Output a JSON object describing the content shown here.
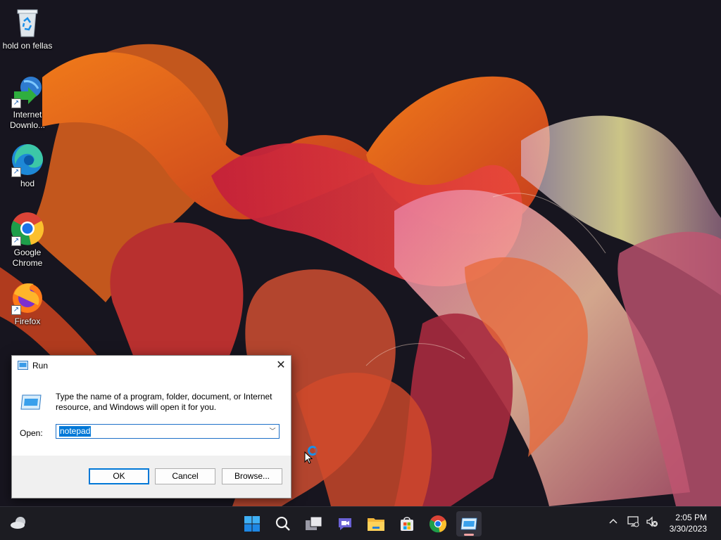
{
  "desktop": {
    "icons": [
      {
        "label": "hold on fellas",
        "icon": "recycle-bin-icon"
      },
      {
        "label": "Internet Downlo...",
        "icon": "internet-download-manager-icon"
      },
      {
        "label": "hod",
        "icon": "edge-icon"
      },
      {
        "label": "Google Chrome",
        "icon": "chrome-icon"
      },
      {
        "label": "Firefox",
        "icon": "firefox-icon"
      }
    ]
  },
  "run_dialog": {
    "title": "Run",
    "description": "Type the name of a program, folder, document, or Internet resource, and Windows will open it for you.",
    "open_label": "Open:",
    "open_value": "notepad",
    "ok_label": "OK",
    "cancel_label": "Cancel",
    "browse_label": "Browse..."
  },
  "taskbar": {
    "items": [
      "start-icon",
      "search-icon",
      "task-view-icon",
      "teams-chat-icon",
      "file-explorer-icon",
      "microsoft-store-icon",
      "chrome-icon",
      "run-icon"
    ],
    "clock_time": "2:05 PM",
    "clock_date": "3/30/2023",
    "accent": "#0078d7"
  }
}
